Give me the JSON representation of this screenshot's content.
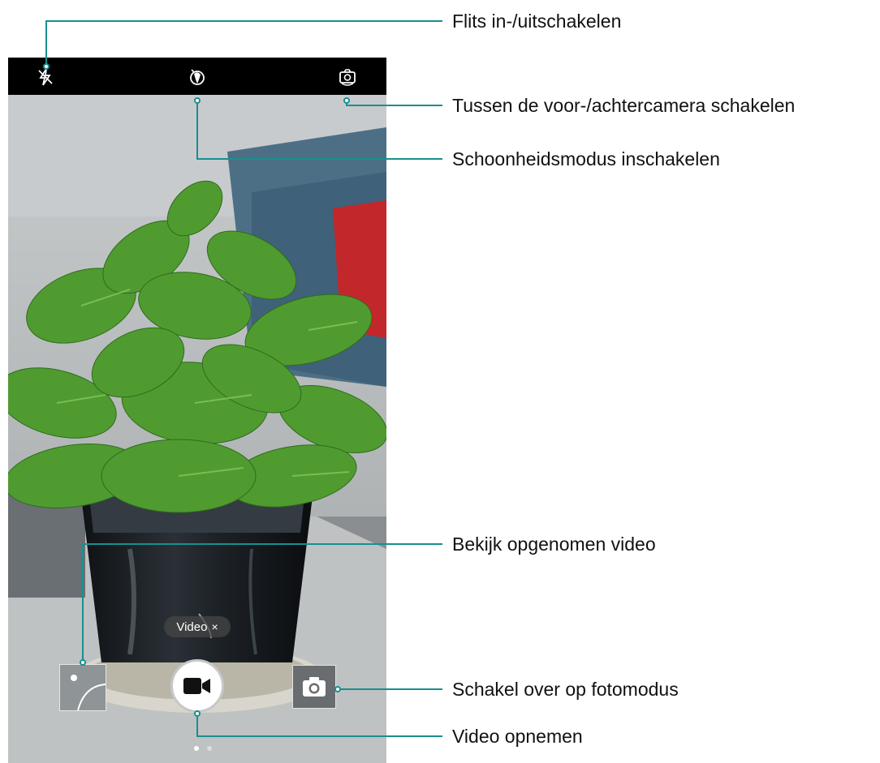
{
  "topbar": {
    "icons": [
      "flash-off-icon",
      "beauty-mode-icon",
      "switch-camera-icon"
    ]
  },
  "viewfinder": {
    "mode_chip_label": "Video",
    "mode_chip_close": "×"
  },
  "controls": {
    "gallery_thumbnail": "gallery-thumbnail",
    "record_button_icon": "video-camera-icon",
    "photo_mode_icon": "camera-icon"
  },
  "callouts": [
    {
      "id": "flash",
      "text": "Flits in-/uitschakelen"
    },
    {
      "id": "switch-camera",
      "text": "Tussen de voor-/achtercamera schakelen"
    },
    {
      "id": "beauty",
      "text": "Schoonheidsmodus inschakelen"
    },
    {
      "id": "gallery",
      "text": "Bekijk opgenomen video"
    },
    {
      "id": "photo-mode",
      "text": "Schakel over op fotomodus"
    },
    {
      "id": "record",
      "text": "Video opnemen"
    }
  ],
  "colors": {
    "callout_line": "#1a8e8f",
    "topbar": "#000000",
    "leaf": "#4e9a31",
    "pot": "#1e2226"
  }
}
